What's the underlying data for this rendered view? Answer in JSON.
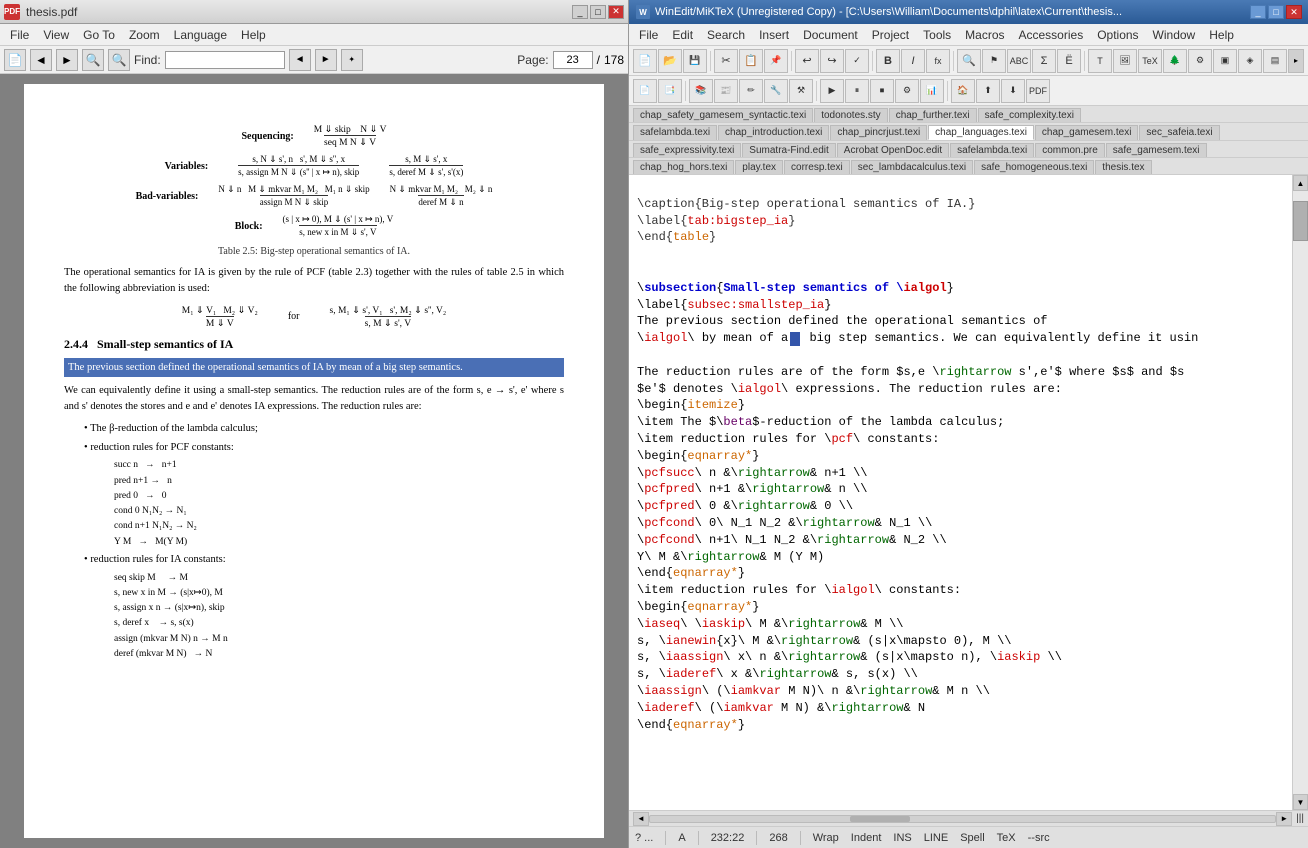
{
  "left": {
    "title": "thesis.pdf",
    "menu": [
      "File",
      "View",
      "Go To",
      "Zoom",
      "Language",
      "Help"
    ],
    "find_label": "Find:",
    "find_placeholder": "",
    "page_label": "Page:",
    "page_current": "23",
    "page_total": "178",
    "nav_prev": "◄",
    "nav_next": "►",
    "content": {
      "sequencing_label": "Sequencing:",
      "variables_label": "Variables:",
      "badvariables_label": "Bad-variables:",
      "block_label": "Block:",
      "caption": "Table 2.5: Big-step operational semantics of IA.",
      "para1": "The operational semantics for IA is given by the rule of PCF (table 2.3) together with the rules of table 2.5 in which the following abbreviation is used:",
      "section": "2.4.4   Small-step semantics of IA",
      "highlight_text": "The previous section defined the operational semantics of IA by mean of a big step semantics.",
      "para2": "We can equivalently define it using a small-step semantics. The reduction rules are of the form s, e → s', e' where s and s' denotes the stores and e and e' denotes IA expressions. The reduction rules are:",
      "bullet1": "The β-reduction of the lambda calculus;",
      "bullet2": "reduction rules for PCF constants:",
      "bullet3": "reduction rules for IA constants:"
    }
  },
  "right": {
    "title": "WinEdit/MiKTeX  (Unregistered Copy)  -  [C:\\Users\\William\\Documents\\dphil\\latex\\Current\\thesis...",
    "menu": [
      "File",
      "Edit",
      "Search",
      "Insert",
      "Document",
      "Project",
      "Tools",
      "Macros",
      "Accessories",
      "Options",
      "Window",
      "Help"
    ],
    "tabs_row1": [
      {
        "label": "chap_safety_gamesem_syntactic.texi",
        "active": false
      },
      {
        "label": "todonotes.sty",
        "active": false
      },
      {
        "label": "chap_further.texi",
        "active": false
      },
      {
        "label": "safe_complexity.texi",
        "active": false
      }
    ],
    "tabs_row2": [
      {
        "label": "safelambda.texi",
        "active": false
      },
      {
        "label": "chap_introduction.texi",
        "active": false
      },
      {
        "label": "chap_pincrjust.texi",
        "active": false
      },
      {
        "label": "chap_languages.texi",
        "active": true
      },
      {
        "label": "chap_gamesem.texi",
        "active": false
      },
      {
        "label": "sec_safeia.texi",
        "active": false
      }
    ],
    "tabs_row3": [
      {
        "label": "safe_expressivity.texi",
        "active": false
      },
      {
        "label": "Sumatra-Find.edit",
        "active": false
      },
      {
        "label": "Acrobat OpenDoc.edit",
        "active": false
      },
      {
        "label": "safelambda.texi",
        "active": false
      },
      {
        "label": "common.pre",
        "active": false
      },
      {
        "label": "safe_gamesem.texi",
        "active": false
      }
    ],
    "tabs_row4": [
      {
        "label": "chap_hog_hors.texi",
        "active": false
      },
      {
        "label": "play.tex",
        "active": false
      },
      {
        "label": "corresp.texi",
        "active": false
      },
      {
        "label": "sec_lambdacalculus.texi",
        "active": false
      },
      {
        "label": "safe_homogeneous.texi",
        "active": false
      },
      {
        "label": "thesis.tex",
        "active": false
      }
    ],
    "statusbar": {
      "item1": "? ...",
      "item2": "A",
      "position": "232:22",
      "col": "268",
      "wrap": "Wrap",
      "indent": "Indent",
      "ins": "INS",
      "line": "LINE",
      "spell": "Spell",
      "tex": "TeX",
      "src": "--src"
    }
  }
}
